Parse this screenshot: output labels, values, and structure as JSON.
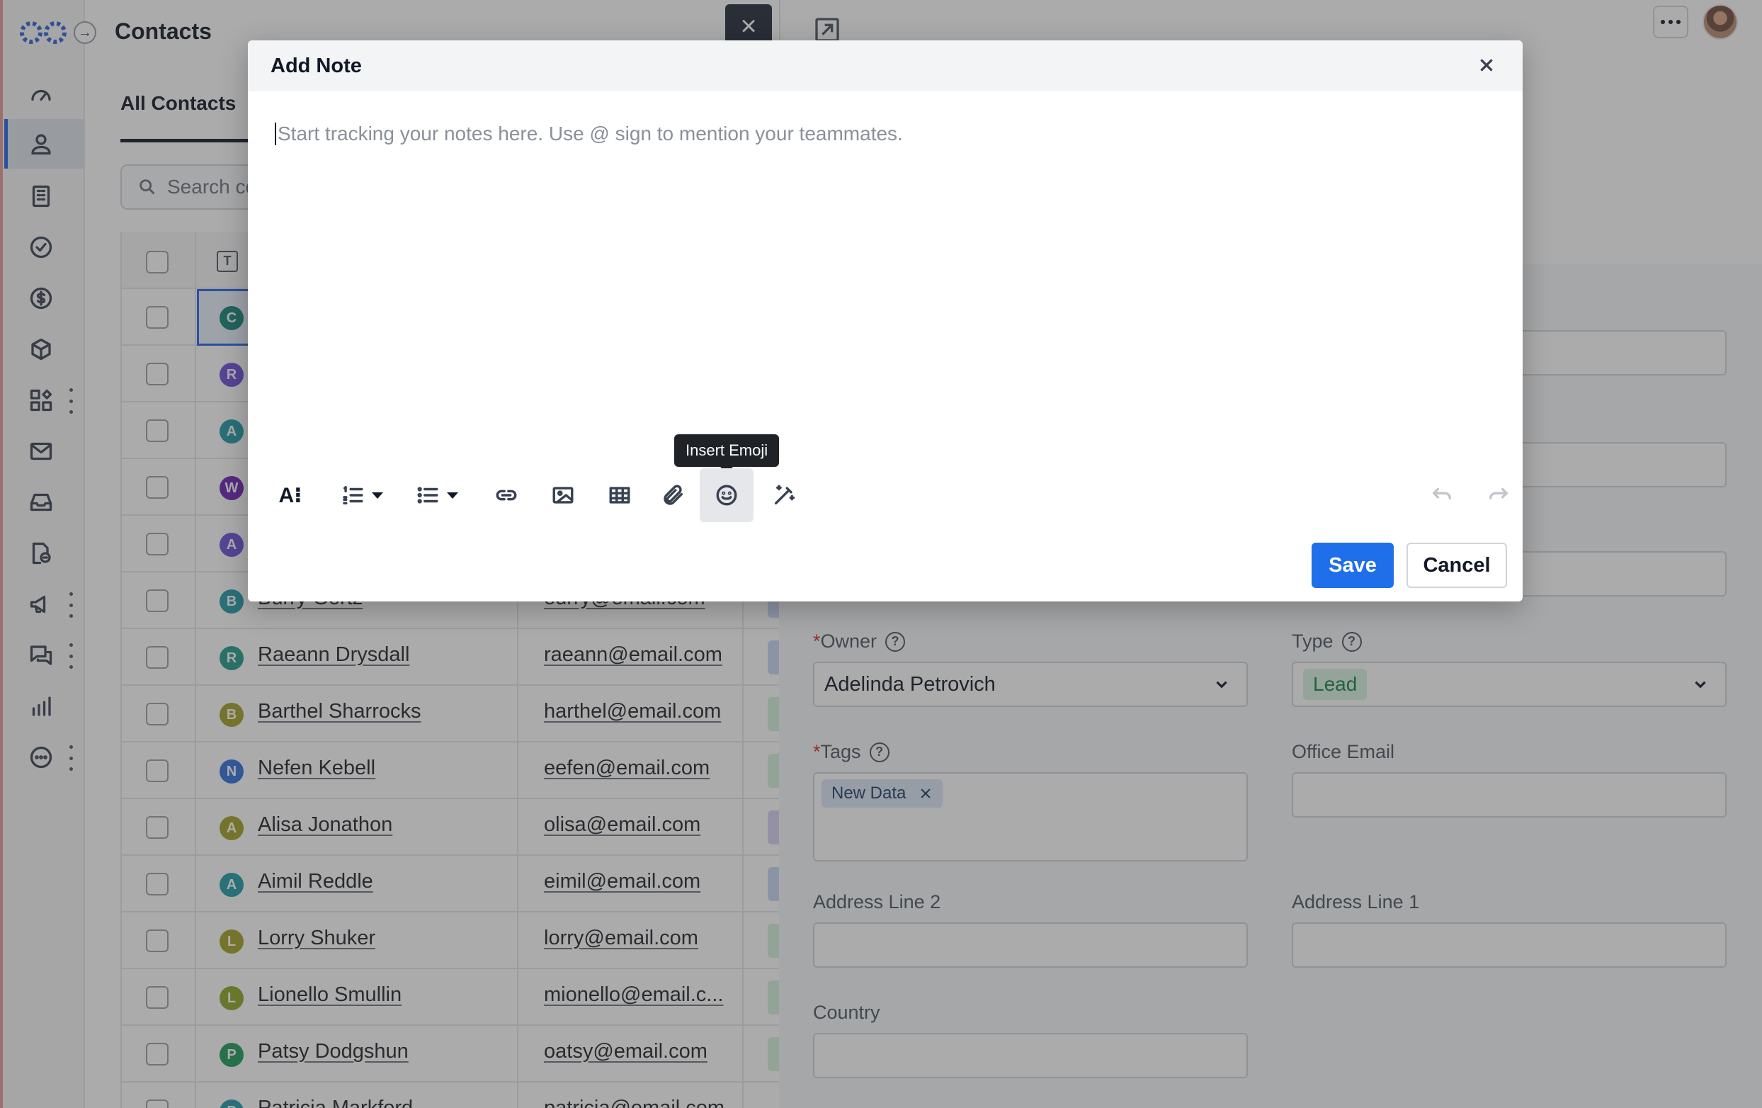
{
  "header": {
    "title": "Contacts"
  },
  "tabs": {
    "all_contacts": "All Contacts"
  },
  "search": {
    "placeholder": "Search co"
  },
  "table": {
    "type_icon": "T",
    "rows": [
      {
        "initial": "C",
        "name": "",
        "email": "",
        "avatar_color": "#14837a",
        "chip": ""
      },
      {
        "initial": "R",
        "name": "",
        "email": "",
        "avatar_color": "#6d4fd9",
        "chip": ""
      },
      {
        "initial": "A",
        "name": "",
        "email": "",
        "avatar_color": "#1f9aa8",
        "chip": ""
      },
      {
        "initial": "W",
        "name": "",
        "email": "",
        "avatar_color": "#6a22b7",
        "chip": ""
      },
      {
        "initial": "A",
        "name": "",
        "email": "",
        "avatar_color": "#6d4fd9",
        "chip": ""
      },
      {
        "initial": "B",
        "name": "Burry Gertz",
        "email": "eurry@email.com",
        "avatar_color": "#1f9aa8",
        "chip": "#c9d8f6"
      },
      {
        "initial": "R",
        "name": "Raeann Drysdall",
        "email": "raeann@email.com",
        "avatar_color": "#1f9a8a",
        "chip": "#c9d8f6"
      },
      {
        "initial": "B",
        "name": "Barthel Sharrocks",
        "email": "harthel@email.com",
        "avatar_color": "#a3a127",
        "chip": "#d4f1dc"
      },
      {
        "initial": "N",
        "name": "Nefen Kebell",
        "email": "eefen@email.com",
        "avatar_color": "#2d6fdc",
        "chip": "#d4f1dc"
      },
      {
        "initial": "A",
        "name": "Alisa Jonathon",
        "email": "olisa@email.com",
        "avatar_color": "#a3a127",
        "chip": "#d9d3f4"
      },
      {
        "initial": "A",
        "name": "Aimil Reddle",
        "email": "eimil@email.com",
        "avatar_color": "#1f9aa8",
        "chip": "#c9d8f6"
      },
      {
        "initial": "L",
        "name": "Lorry Shuker",
        "email": "lorry@email.com",
        "avatar_color": "#a3a127",
        "chip": "#d4f1dc"
      },
      {
        "initial": "L",
        "name": "Lionello Smullin",
        "email": "mionello@email.c...",
        "avatar_color": "#8aa727",
        "chip": "#d4f1dc"
      },
      {
        "initial": "P",
        "name": "Patsy Dodgshun",
        "email": "oatsy@email.com",
        "avatar_color": "#1e9a58",
        "chip": "#d4f1dc"
      },
      {
        "initial": "P",
        "name": "Patricia Markford",
        "email": "patricia@email.com",
        "avatar_color": "#1f9aa8",
        "chip": ""
      }
    ]
  },
  "detail": {
    "owner_label": "Owner",
    "owner_value": "Adelinda Petrovich",
    "type_label": "Type",
    "type_value": "Lead",
    "tags_label": "Tags",
    "tag_value": "New Data",
    "office_email_label": "Office Email",
    "address2_label": "Address Line 2",
    "address1_label": "Address Line 1",
    "country_label": "Country",
    "required_mark": "*",
    "help_mark": "?"
  },
  "modal": {
    "title": "Add Note",
    "placeholder": "Start tracking your notes here. Use @ sign to mention your teammates.",
    "tooltip": "Insert Emoji",
    "save_label": "Save",
    "cancel_label": "Cancel",
    "format_label": "A⁝"
  },
  "colors": {
    "accent": "#1f6feb",
    "overlay": "rgba(55,55,55,0.42)",
    "lead_badge_bg": "#d8f3e3",
    "lead_badge_text": "#15803d"
  },
  "icons": {
    "sidebar": [
      "dashboard-icon",
      "contacts-icon",
      "companies-icon",
      "tasks-icon",
      "deals-icon",
      "products-icon",
      "apps-icon",
      "email-icon",
      "inbox-icon",
      "documents-icon",
      "campaigns-icon",
      "chat-icon",
      "reports-icon",
      "more-icon"
    ],
    "toolbar": [
      "text-format-icon",
      "numbered-list-icon",
      "bullet-list-icon",
      "link-icon",
      "image-icon",
      "table-icon",
      "attachment-icon",
      "emoji-icon",
      "magic-wand-icon",
      "undo-icon",
      "redo-icon"
    ]
  }
}
